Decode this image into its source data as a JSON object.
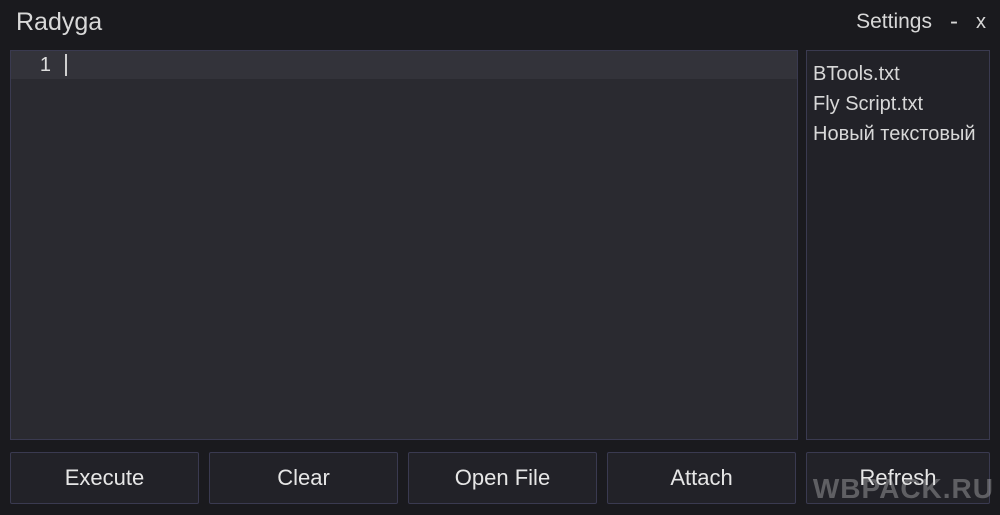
{
  "titlebar": {
    "title": "Radyga",
    "settings_label": "Settings",
    "minimize_label": "-",
    "close_label": "x"
  },
  "editor": {
    "line_number": "1"
  },
  "files": {
    "items": [
      {
        "name": "BTools.txt"
      },
      {
        "name": "Fly Script.txt"
      },
      {
        "name": "Новый текстовый"
      }
    ]
  },
  "buttons": {
    "execute": "Execute",
    "clear": "Clear",
    "open_file": "Open File",
    "attach": "Attach",
    "refresh": "Refresh"
  },
  "watermark": "WBPACK.RU"
}
